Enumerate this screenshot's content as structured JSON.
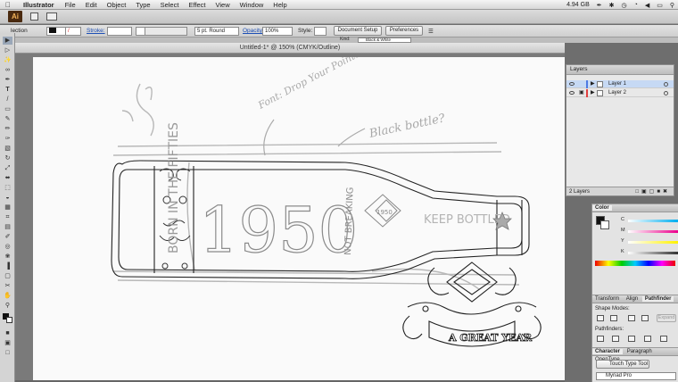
{
  "menubar": {
    "app_name": "Illustrator",
    "items": [
      "File",
      "Edit",
      "Object",
      "Type",
      "Select",
      "Effect",
      "View",
      "Window",
      "Help"
    ],
    "status_text": "4.94 GB"
  },
  "appbar": {
    "logo": "Ai"
  },
  "control_bar": {
    "selection_label": "lection",
    "stroke_label": "Stroke:",
    "brush_value": "5 pt. Round",
    "opacity_label": "Opacity:",
    "opacity_value": "100%",
    "style_label": "Style:",
    "document_setup_label": "Document Setup",
    "preferences_label": "Preferences",
    "kind_label": "Kind:",
    "kind_value": "Black & White"
  },
  "document": {
    "title": "Untitled-1* @ 150% (CMYK/Outline)"
  },
  "sketch": {
    "note_top": "Font: Drop Your Pointer",
    "note_right": "Black bottle?",
    "year": "1950",
    "side_text": "BORN IN THE FIFTIES",
    "middle_text": "NOT BREAKING",
    "right_text": "KEEP BOTTLED",
    "badge_year": "1950",
    "banner_text": "A GREAT YEAR"
  },
  "layers_panel": {
    "tab": "Layers",
    "layers": [
      {
        "name": "Layer 1",
        "selected": true,
        "color": "#4d7ae3"
      },
      {
        "name": "Layer 2",
        "selected": false,
        "color": "#e04040"
      }
    ],
    "footer": "2 Layers"
  },
  "color_panel": {
    "tab": "Color",
    "channels": [
      "C",
      "M",
      "Y",
      "K"
    ]
  },
  "pathfinder_panel": {
    "tabs": [
      "Transform",
      "Align",
      "Pathfinder"
    ],
    "shape_modes_label": "Shape Modes:",
    "pathfinders_label": "Pathfinders:",
    "expand_label": "Expand"
  },
  "character_panel": {
    "tabs": [
      "Character",
      "Paragraph",
      "OpenType"
    ],
    "touch_type_label": "Touch Type Tool",
    "font_value": "Myriad Pro"
  }
}
